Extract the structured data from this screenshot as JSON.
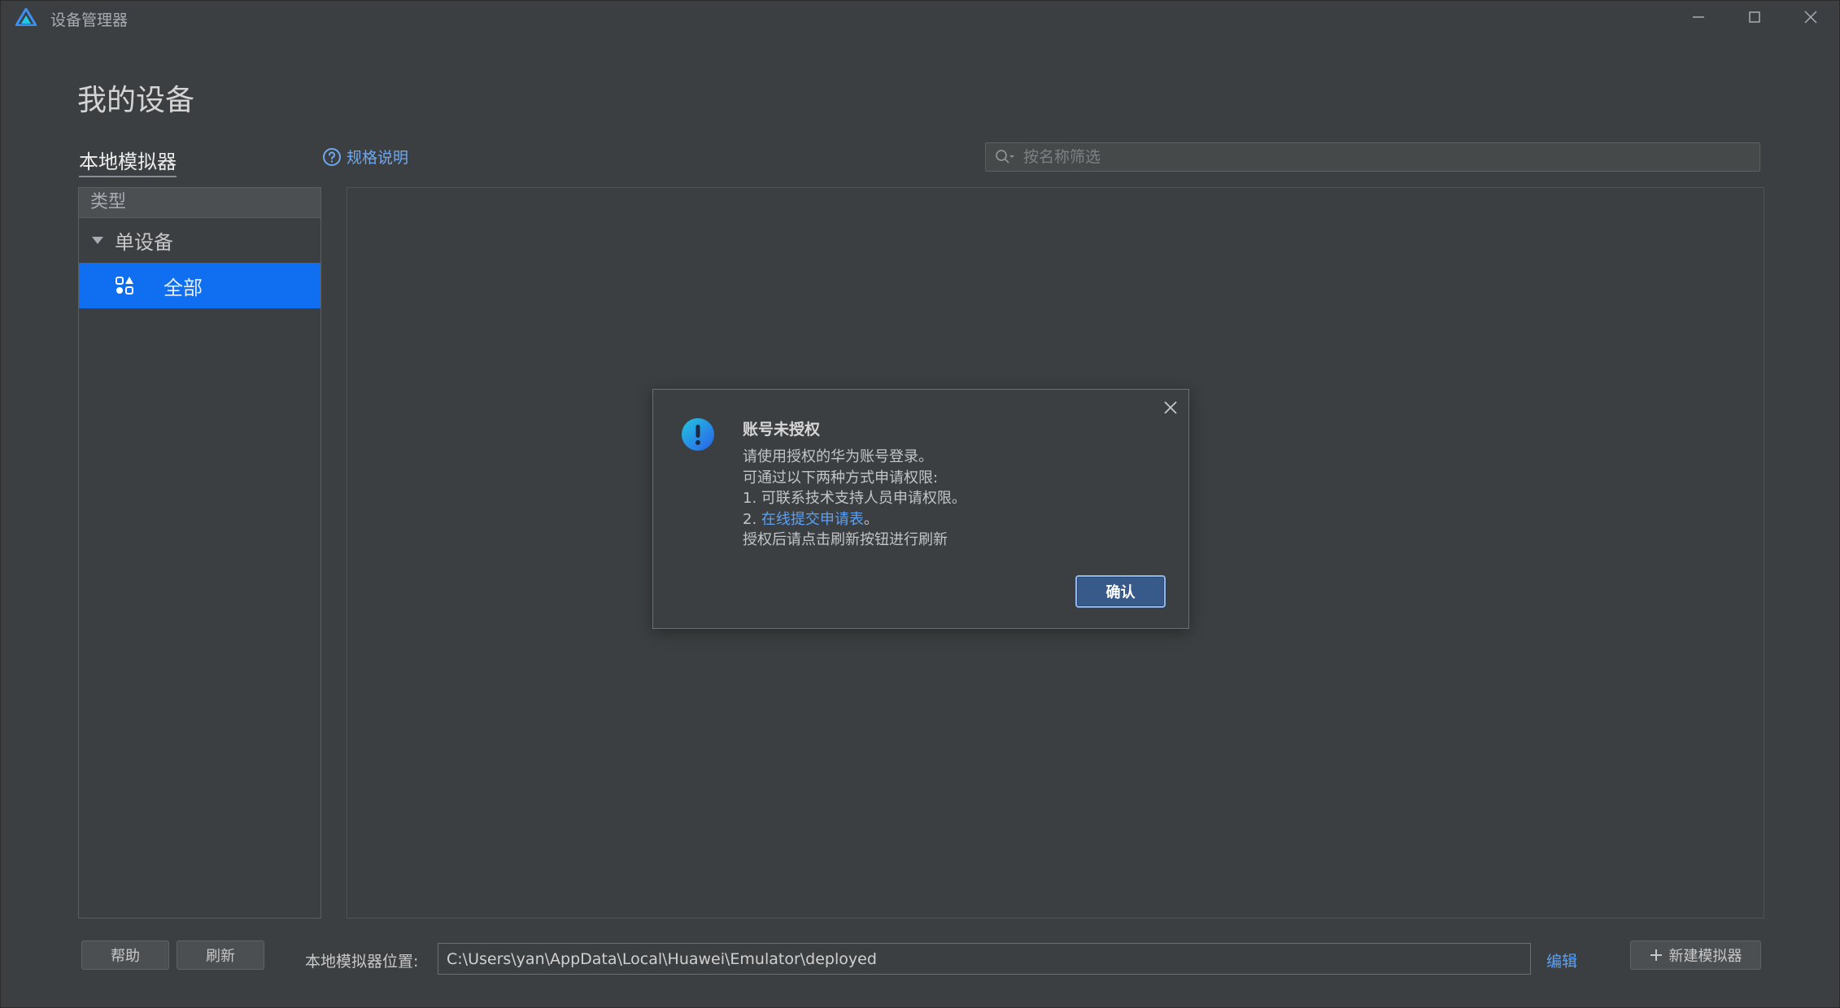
{
  "window": {
    "title": "设备管理器"
  },
  "page": {
    "title": "我的设备",
    "section_tab": "本地模拟器",
    "spec_link": "规格说明",
    "search_placeholder": "按名称筛选"
  },
  "left_panel": {
    "header": "类型",
    "group_label": "单设备",
    "item_label": "全部"
  },
  "dialog": {
    "title": "账号未授权",
    "lines": {
      "l1": "请使用授权的华为账号登录。",
      "l2": "可通过以下两种方式申请权限:",
      "l3": "1. 可联系技术支持人员申请权限。",
      "l4_prefix": "2. ",
      "l4_link": "在线提交申请表",
      "l4_suffix": "。",
      "l5": "授权后请点击刷新按钮进行刷新"
    },
    "confirm_label": "确认",
    "accent": "#0f6ff0"
  },
  "footer": {
    "help_label": "帮助",
    "refresh_label": "刷新",
    "path_label": "本地模拟器位置:",
    "path_value": "C:\\Users\\yan\\AppData\\Local\\Huawei\\Emulator\\deployed",
    "edit_label": "编辑",
    "new_label": "新建模拟器"
  },
  "icons": {
    "app": "deveco-logo-icon",
    "search": "search-icon",
    "help": "question-circle-icon",
    "all": "shapes-grid-icon",
    "warning": "exclamation-icon",
    "close": "close-icon",
    "add": "plus-icon"
  }
}
